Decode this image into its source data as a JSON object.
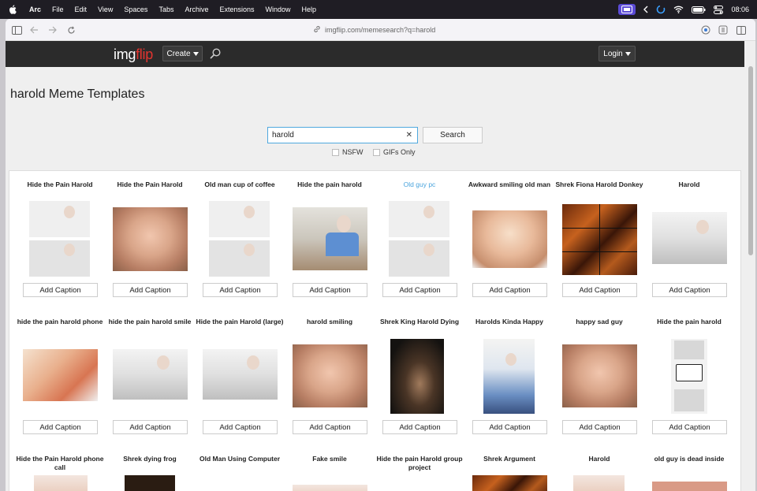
{
  "menubar": {
    "app": "Arc",
    "items": [
      "File",
      "Edit",
      "View",
      "Spaces",
      "Tabs",
      "Archive",
      "Extensions",
      "Window",
      "Help"
    ],
    "time": "08:06"
  },
  "browser": {
    "url": "imgflip.com/memesearch?q=harold"
  },
  "site": {
    "logo_a": "img",
    "logo_b": "flip",
    "create_label": "Create",
    "login_label": "Login"
  },
  "page": {
    "title": "harold Meme Templates",
    "search_value": "harold",
    "search_button": "Search",
    "filter_nsfw": "NSFW",
    "filter_gifs": "GIFs Only"
  },
  "caption_label": "Add Caption",
  "rows": [
    [
      {
        "title": "Hide the Pain Harold"
      },
      {
        "title": "Hide the Pain Harold"
      },
      {
        "title": "Old man cup of coffee"
      },
      {
        "title": "Hide the pain harold"
      },
      {
        "title": "Old guy pc"
      },
      {
        "title": "Awkward smiling old man"
      },
      {
        "title": "Shrek Fiona Harold Donkey"
      },
      {
        "title": "Harold"
      }
    ],
    [
      {
        "title": "hide the pain harold phone"
      },
      {
        "title": "hide the pain harold smile"
      },
      {
        "title": "Hide the pain Harold (large)"
      },
      {
        "title": "harold smiling"
      },
      {
        "title": "Shrek King Harold Dying"
      },
      {
        "title": "Harolds Kinda Happy"
      },
      {
        "title": "happy sad guy"
      },
      {
        "title": "Hide the pain harold"
      }
    ],
    [
      {
        "title": "Hide the Pain Harold phone call"
      },
      {
        "title": "Shrek dying frog"
      },
      {
        "title": "Old Man Using Computer"
      },
      {
        "title": "Fake smile"
      },
      {
        "title": "Hide the pain Harold group project"
      },
      {
        "title": "Shrek Argument"
      },
      {
        "title": "Harold"
      },
      {
        "title": "old guy is dead inside"
      }
    ]
  ]
}
